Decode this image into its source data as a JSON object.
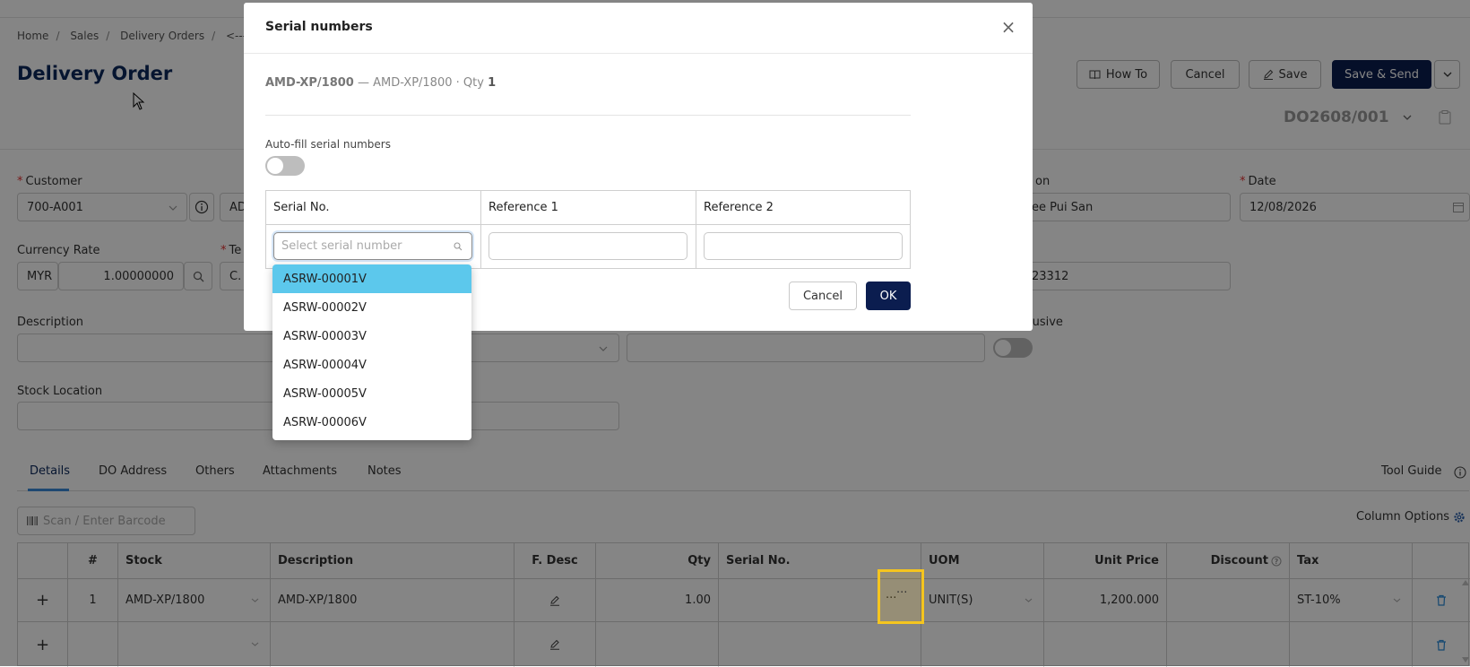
{
  "breadcrumb": {
    "items": [
      "Home",
      "Sales",
      "Delivery Orders",
      "<---"
    ]
  },
  "page": {
    "title": "Delivery Order",
    "doc_no": "DO2608/001"
  },
  "toolbar": {
    "how_to": "How To",
    "cancel": "Cancel",
    "save": "Save",
    "save_send": "Save & Send"
  },
  "form": {
    "customer_label": "Customer",
    "customer_value": "700-A001",
    "customer_extra": "AD",
    "location_label": "on",
    "location_value": "ee Pui San",
    "date_label": "Date",
    "date_value": "12/08/2026",
    "currency_label": "Currency Rate",
    "currency_code": "MYR",
    "currency_rate": "1.00000000",
    "terms_label": "Te",
    "terms_value": "C.",
    "phone_value": "23312",
    "description_label": "Description",
    "inclusive_label": "lusive",
    "stock_location_label": "Stock Location"
  },
  "tabs": [
    "Details",
    "DO Address",
    "Others",
    "Attachments",
    "Notes"
  ],
  "tool_guide": "Tool Guide",
  "barcode_placeholder": "Scan / Enter Barcode",
  "column_options": "Column Options",
  "grid": {
    "headers": [
      "#",
      "Stock",
      "Description",
      "F. Desc",
      "Qty",
      "Serial No.",
      "UOM",
      "Unit Price",
      "Discount",
      "Tax"
    ],
    "rows": [
      {
        "no": "1",
        "stock": "AMD-XP/1800",
        "description": "AMD-XP/1800",
        "qty": "1.00",
        "serial": "···",
        "uom": "UNIT(S)",
        "unit_price": "1,200.000",
        "discount": "",
        "tax": "ST-10%"
      },
      {
        "no": "",
        "stock": "",
        "description": "",
        "qty": "",
        "serial": "",
        "uom": "",
        "unit_price": "",
        "discount": "",
        "tax": ""
      }
    ]
  },
  "modal": {
    "title": "Serial numbers",
    "item_code": "AMD-XP/1800",
    "item_detail": " — AMD-XP/1800 · Qty ",
    "item_qty": "1",
    "autofill_label": "Auto-fill serial numbers",
    "headers": [
      "Serial No.",
      "Reference 1",
      "Reference 2"
    ],
    "serial_placeholder": "Select serial number",
    "options": [
      "ASRW-00001V",
      "ASRW-00002V",
      "ASRW-00003V",
      "ASRW-00004V",
      "ASRW-00005V",
      "ASRW-00006V"
    ],
    "cancel": "Cancel",
    "ok": "OK"
  },
  "colors": {
    "primary": "#0b1d4f",
    "selected_option": "#5cc8ec",
    "highlight": "#f5c51f",
    "link": "#3a8ad9"
  }
}
